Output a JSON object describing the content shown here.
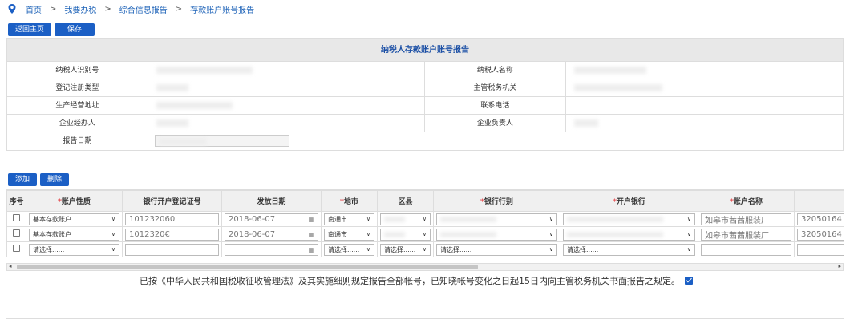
{
  "breadcrumb": [
    "首页",
    "我要办税",
    "综合信息报告",
    "存款账户账号报告"
  ],
  "breadcrumb_sep": ">",
  "toolbar": {
    "home_label": "返回主页",
    "save_label": "保存"
  },
  "report": {
    "title": "纳税人存款账户账号报告",
    "labels": {
      "taxpayer_id": "纳税人识别号",
      "taxpayer_name": "纳税人名称",
      "reg_type": "登记注册类型",
      "tax_authority": "主管税务机关",
      "address": "生产经营地址",
      "phone": "联系电话",
      "agent": "企业经办人",
      "principal": "企业负责人",
      "report_date": "报告日期"
    }
  },
  "actions": {
    "add_label": "添加",
    "delete_label": "删除"
  },
  "grid": {
    "headers": {
      "seq": "序号",
      "acct_type": "账户性质",
      "license": "银行开户登记证号",
      "issue_date": "发放日期",
      "city": "地市",
      "district": "区县",
      "bank_type": "银行行别",
      "bank": "开户银行",
      "acct_name": "账户名称",
      "acct_no": "账"
    },
    "rows": [
      {
        "acct_type": "基本存款账户",
        "license": "101232060",
        "issue_date": "2018-06-07",
        "city": "南通市",
        "acct_name": "如皋市茜茜服装厂",
        "acct_no": "32050164"
      },
      {
        "acct_type": "基本存款账户",
        "license": "1012320€",
        "issue_date": "2018-06-07",
        "city": "南通市",
        "acct_name": "如皋市茜茜服装厂",
        "acct_no": "32050164"
      },
      {
        "acct_type": "请选择......",
        "license": "",
        "issue_date": "",
        "city": "请选择......",
        "district": "请选择......",
        "bank_type": "请选择......",
        "bank": "请选择......",
        "acct_name": "",
        "acct_no": ""
      }
    ]
  },
  "notice": "已按《中华人民共和国税收征收管理法》及其实施细则规定报告全部帐号，已知晓帐号变化之日起15日内向主管税务机关书面报告之规定。"
}
